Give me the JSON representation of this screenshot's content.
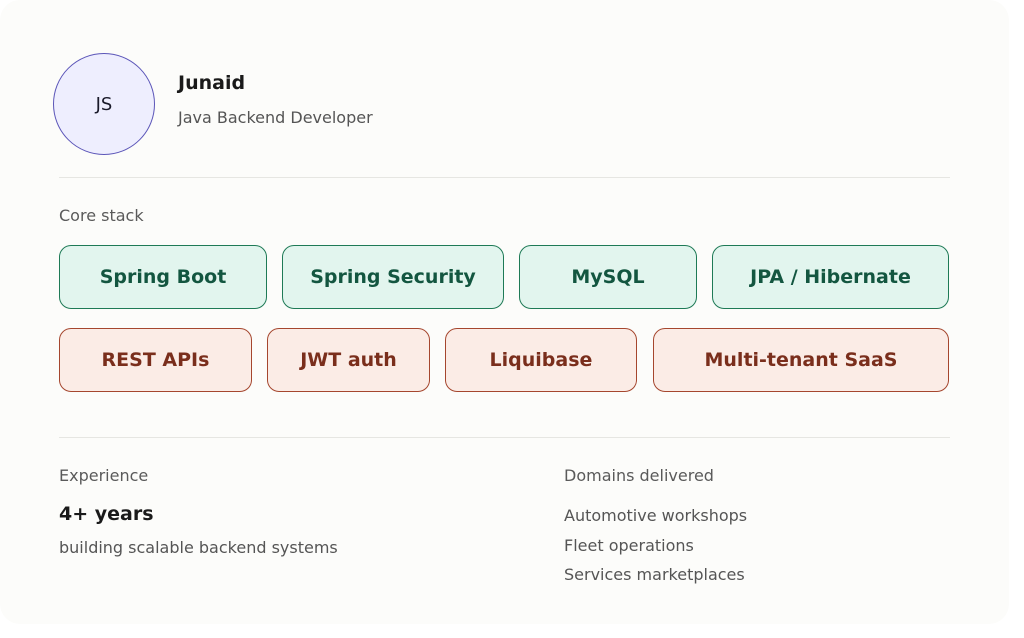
{
  "profile": {
    "initials": "JS",
    "name": "Junaid",
    "role": "Java Backend Developer"
  },
  "stack": {
    "label": "Core stack",
    "primary": [
      "Spring Boot",
      "Spring Security",
      "MySQL",
      "JPA / Hibernate"
    ],
    "secondary": [
      "REST APIs",
      "JWT auth",
      "Liquibase",
      "Multi-tenant SaaS"
    ]
  },
  "experience": {
    "label": "Experience",
    "value": "4+ years",
    "description": "building scalable backend systems"
  },
  "domains": {
    "label": "Domains delivered",
    "items": [
      "Automotive workshops",
      "Fleet operations",
      "Services marketplaces"
    ]
  },
  "colors": {
    "primary_chip_border": "#1e7a56",
    "primary_chip_fill": "#e2f5ee",
    "secondary_chip_border": "#a5462e",
    "secondary_chip_fill": "#fbece6",
    "avatar_border": "#5b55b8"
  }
}
